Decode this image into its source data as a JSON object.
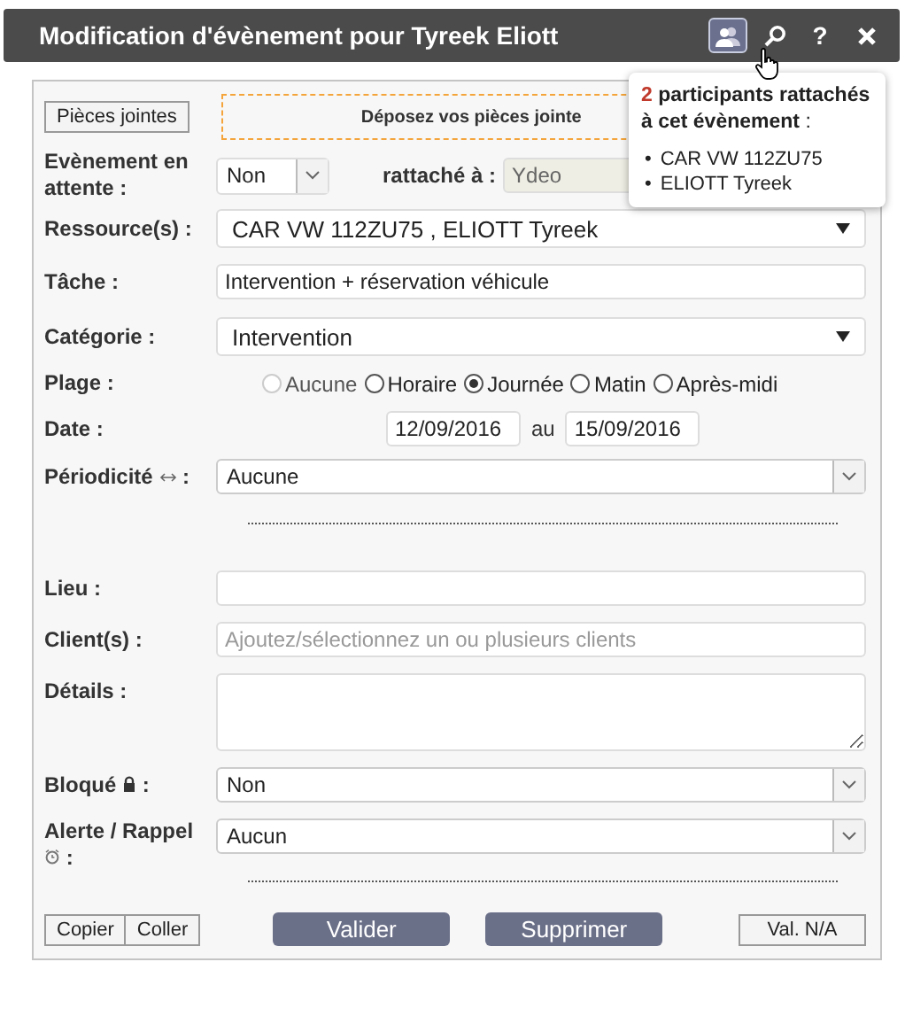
{
  "window": {
    "title": "Modification d'évènement pour Tyreek Eliott"
  },
  "toolbar": [
    {
      "kind": "participants",
      "selected": true
    },
    {
      "kind": "search",
      "selected": false
    },
    {
      "kind": "help",
      "label": "?",
      "selected": false
    },
    {
      "kind": "close",
      "selected": false
    }
  ],
  "tooltip": {
    "count": "2",
    "text": "**participants rattachés à cet évènement** :",
    "marker": "•",
    "items": [
      "CAR VW 112ZU75",
      "ELIOTT Tyreek"
    ]
  },
  "attachments": {
    "button": "Pièces jointes",
    "dropzone": "Déposez vos pièces jointe"
  },
  "pending": {
    "label": "Evènement en attente :",
    "value": "Non",
    "attached_label": "rattaché à :",
    "attached_value": "Ydeo"
  },
  "resources": {
    "label": "Ressource(s) :",
    "value": "CAR VW 112ZU75 , ELIOTT Tyreek"
  },
  "task": {
    "label": "Tâche :",
    "value": "Intervention + réservation véhicule"
  },
  "category": {
    "label": "Catégorie :",
    "value": "Intervention"
  },
  "range": {
    "label": "Plage :",
    "options": [
      {
        "label": "Aucune",
        "selected": false,
        "disabled": true
      },
      {
        "label": "Horaire",
        "selected": false,
        "disabled": false
      },
      {
        "label": "Journée",
        "selected": true,
        "disabled": false
      },
      {
        "label": "Matin",
        "selected": false,
        "disabled": false
      },
      {
        "label": "Après-midi",
        "selected": false,
        "disabled": false
      }
    ]
  },
  "date": {
    "label": "Date :",
    "from": "12/09/2016",
    "separator": "au",
    "to": "15/09/2016"
  },
  "periodicity": {
    "label": "Périodicité",
    "suffix": ":",
    "value": "Aucune"
  },
  "place": {
    "label": "Lieu :"
  },
  "clients": {
    "label": "Client(s) :",
    "placeholder": "Ajoutez/sélectionnez un ou plusieurs clients"
  },
  "details": {
    "label": "Détails :"
  },
  "locked": {
    "label": "Bloqué",
    "suffix": ":",
    "value": "Non"
  },
  "alert": {
    "label": "Alerte / Rappel",
    "suffix": ":",
    "value": "Aucun"
  },
  "footer": {
    "copy": "Copier",
    "paste": "Coller",
    "validate": "Valider",
    "delete": "Supprimer",
    "na": "Val. N/A"
  }
}
